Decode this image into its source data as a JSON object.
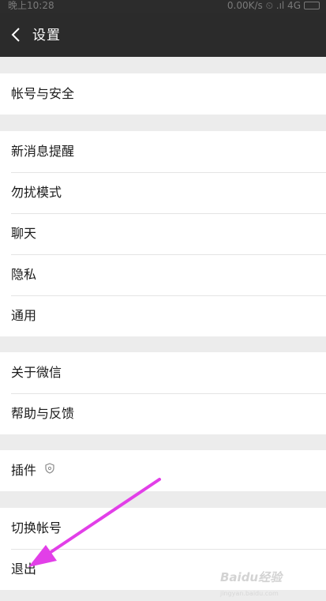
{
  "status_bar": {
    "time": "晚上10:28",
    "right": "0.00K/s ⏲ .ıl 4G"
  },
  "header": {
    "title": "设置",
    "back_icon": "chevron-left-icon"
  },
  "groups": [
    {
      "items": [
        "帐号与安全"
      ]
    },
    {
      "items": [
        "新消息提醒",
        "勿扰模式",
        "聊天",
        "隐私",
        "通用"
      ]
    },
    {
      "items": [
        "关于微信",
        "帮助与反馈"
      ]
    },
    {
      "items": [
        "插件"
      ],
      "plugin_icon": "shield-icon"
    },
    {
      "items": [
        "切换帐号",
        "退出"
      ]
    }
  ],
  "watermark": {
    "text": "Baidu经验",
    "sub": "jingyan.baidu.com"
  },
  "annotation": {
    "color": "#e23fe8"
  },
  "colors": {
    "header_bg": "#2b2b2b",
    "page_bg": "#ececec",
    "item_bg": "#ffffff"
  }
}
